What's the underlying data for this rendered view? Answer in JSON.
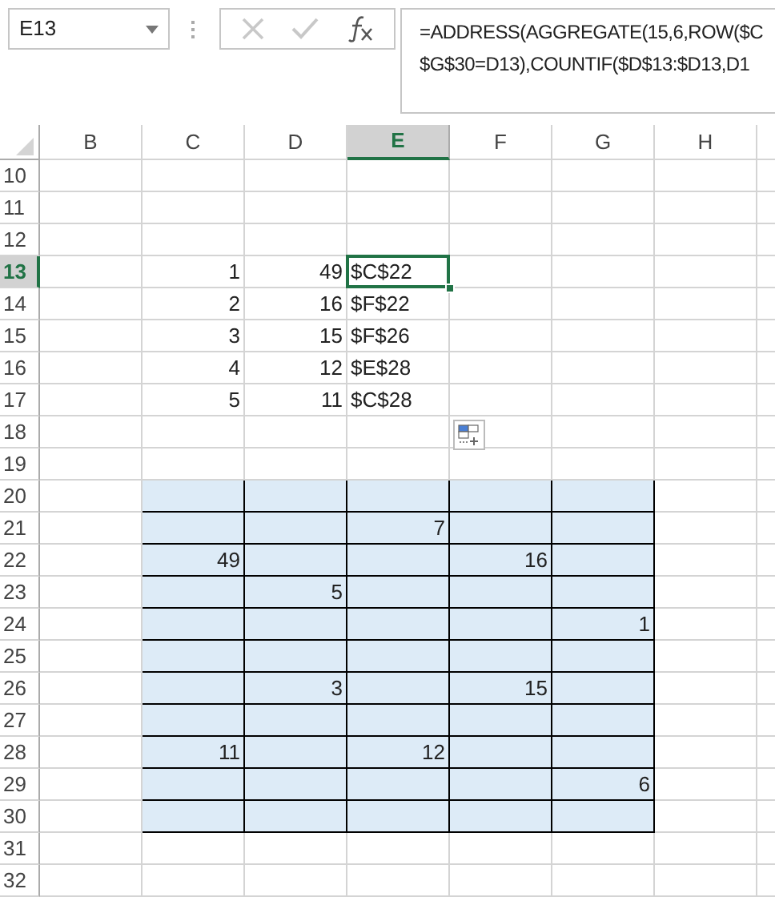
{
  "name_box": {
    "value": "E13"
  },
  "formula_bar": {
    "lines": [
      "=ADDRESS(AGGREGATE(15,6,ROW($C",
      "$G$30=D13),COUNTIF($D$13:$D13,D1"
    ]
  },
  "columns": [
    {
      "label": "B",
      "selected": false
    },
    {
      "label": "C",
      "selected": false
    },
    {
      "label": "D",
      "selected": false
    },
    {
      "label": "E",
      "selected": true
    },
    {
      "label": "F",
      "selected": false
    },
    {
      "label": "G",
      "selected": false
    },
    {
      "label": "H",
      "selected": false
    }
  ],
  "rows": [
    {
      "label": "10",
      "selected": false,
      "cells": [
        null,
        null,
        null,
        null,
        null,
        null,
        null
      ]
    },
    {
      "label": "11",
      "selected": false,
      "cells": [
        null,
        null,
        null,
        null,
        null,
        null,
        null
      ]
    },
    {
      "label": "12",
      "selected": false,
      "cells": [
        null,
        null,
        null,
        null,
        null,
        null,
        null
      ]
    },
    {
      "label": "13",
      "selected": true,
      "cells": [
        null,
        {
          "value": "1",
          "shaded": false
        },
        {
          "value": "49",
          "shaded": false
        },
        {
          "value": "$C$22",
          "shaded": false,
          "kind": "text"
        },
        null,
        null,
        null
      ]
    },
    {
      "label": "14",
      "selected": false,
      "cells": [
        null,
        {
          "value": "2",
          "shaded": false
        },
        {
          "value": "16",
          "shaded": false
        },
        {
          "value": "$F$22",
          "shaded": false,
          "kind": "text"
        },
        null,
        null,
        null
      ]
    },
    {
      "label": "15",
      "selected": false,
      "cells": [
        null,
        {
          "value": "3",
          "shaded": false
        },
        {
          "value": "15",
          "shaded": false
        },
        {
          "value": "$F$26",
          "shaded": false,
          "kind": "text"
        },
        null,
        null,
        null
      ]
    },
    {
      "label": "16",
      "selected": false,
      "cells": [
        null,
        {
          "value": "4",
          "shaded": false
        },
        {
          "value": "12",
          "shaded": false
        },
        {
          "value": "$E$28",
          "shaded": false,
          "kind": "text"
        },
        null,
        null,
        null
      ]
    },
    {
      "label": "17",
      "selected": false,
      "cells": [
        null,
        {
          "value": "5",
          "shaded": false
        },
        {
          "value": "11",
          "shaded": false
        },
        {
          "value": "$C$28",
          "shaded": false,
          "kind": "text"
        },
        null,
        null,
        null
      ]
    },
    {
      "label": "18",
      "selected": false,
      "cells": [
        null,
        null,
        null,
        null,
        null,
        null,
        null
      ]
    },
    {
      "label": "19",
      "selected": false,
      "cells": [
        null,
        null,
        null,
        null,
        null,
        null,
        null
      ]
    },
    {
      "label": "20",
      "selected": false,
      "cells": [
        null,
        {
          "shaded": true
        },
        {
          "shaded": true
        },
        {
          "shaded": true
        },
        {
          "shaded": true
        },
        {
          "shaded": true
        },
        null
      ]
    },
    {
      "label": "21",
      "selected": false,
      "cells": [
        null,
        {
          "shaded": true
        },
        {
          "shaded": true
        },
        {
          "value": "7",
          "shaded": true
        },
        {
          "shaded": true
        },
        {
          "shaded": true
        },
        null
      ]
    },
    {
      "label": "22",
      "selected": false,
      "cells": [
        null,
        {
          "value": "49",
          "shaded": true
        },
        {
          "shaded": true
        },
        {
          "shaded": true
        },
        {
          "value": "16",
          "shaded": true
        },
        {
          "shaded": true
        },
        null
      ]
    },
    {
      "label": "23",
      "selected": false,
      "cells": [
        null,
        {
          "shaded": true
        },
        {
          "value": "5",
          "shaded": true
        },
        {
          "shaded": true
        },
        {
          "shaded": true
        },
        {
          "shaded": true
        },
        null
      ]
    },
    {
      "label": "24",
      "selected": false,
      "cells": [
        null,
        {
          "shaded": true
        },
        {
          "shaded": true
        },
        {
          "shaded": true
        },
        {
          "shaded": true
        },
        {
          "value": "1",
          "shaded": true
        },
        null
      ]
    },
    {
      "label": "25",
      "selected": false,
      "cells": [
        null,
        {
          "shaded": true
        },
        {
          "shaded": true
        },
        {
          "shaded": true
        },
        {
          "shaded": true
        },
        {
          "shaded": true
        },
        null
      ]
    },
    {
      "label": "26",
      "selected": false,
      "cells": [
        null,
        {
          "shaded": true
        },
        {
          "value": "3",
          "shaded": true
        },
        {
          "shaded": true
        },
        {
          "value": "15",
          "shaded": true
        },
        {
          "shaded": true
        },
        null
      ]
    },
    {
      "label": "27",
      "selected": false,
      "cells": [
        null,
        {
          "shaded": true
        },
        {
          "shaded": true
        },
        {
          "shaded": true
        },
        {
          "shaded": true
        },
        {
          "shaded": true
        },
        null
      ]
    },
    {
      "label": "28",
      "selected": false,
      "cells": [
        null,
        {
          "value": "11",
          "shaded": true
        },
        {
          "shaded": true
        },
        {
          "value": "12",
          "shaded": true
        },
        {
          "shaded": true
        },
        {
          "shaded": true
        },
        null
      ]
    },
    {
      "label": "29",
      "selected": false,
      "cells": [
        null,
        {
          "shaded": true
        },
        {
          "shaded": true
        },
        {
          "shaded": true
        },
        {
          "shaded": true
        },
        {
          "value": "6",
          "shaded": true
        },
        null
      ]
    },
    {
      "label": "30",
      "selected": false,
      "cells": [
        null,
        {
          "shaded": true
        },
        {
          "shaded": true
        },
        {
          "shaded": true
        },
        {
          "shaded": true
        },
        {
          "shaded": true
        },
        null
      ]
    },
    {
      "label": "31",
      "selected": false,
      "cells": [
        null,
        null,
        null,
        null,
        null,
        null,
        null
      ]
    },
    {
      "label": "32",
      "selected": false,
      "cells": [
        null,
        null,
        null,
        null,
        null,
        null,
        null
      ]
    }
  ],
  "paste_options": {
    "shown": true
  }
}
